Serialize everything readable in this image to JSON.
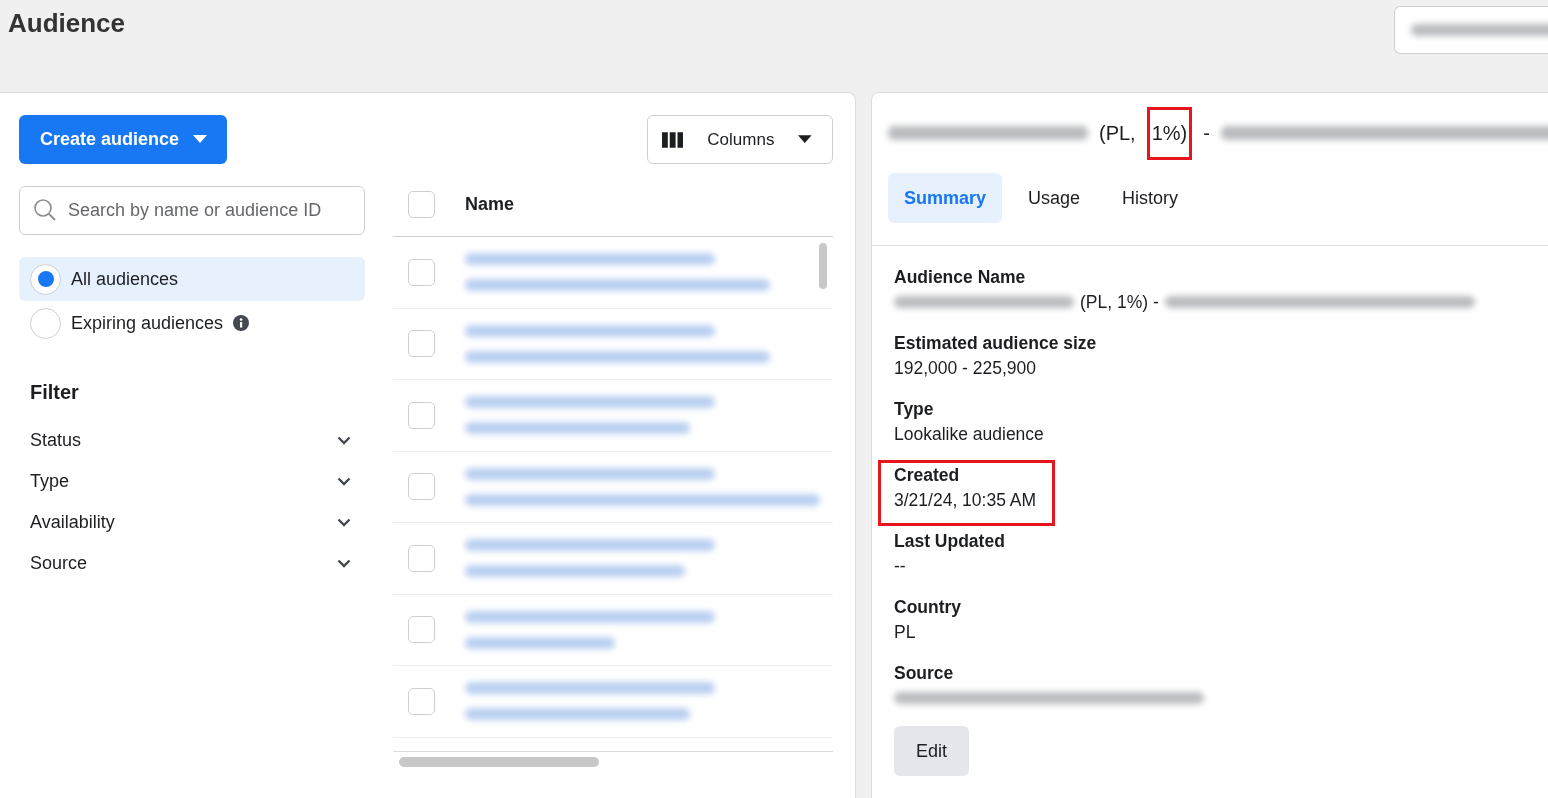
{
  "page": {
    "title": "Audience"
  },
  "account_selector": {
    "kind": "blurred"
  },
  "create_button": {
    "label": "Create audience"
  },
  "search": {
    "placeholder": "Search by name or audience ID"
  },
  "audience_scope": [
    {
      "label": "All audiences",
      "selected": true,
      "info": false
    },
    {
      "label": "Expiring audiences",
      "selected": false,
      "info": true
    }
  ],
  "filter": {
    "title": "Filter",
    "items": [
      {
        "label": "Status",
        "expanded": false
      },
      {
        "label": "Type",
        "expanded": false
      },
      {
        "label": "Availability",
        "expanded": false
      },
      {
        "label": "Source",
        "expanded": false
      }
    ]
  },
  "columns_button": {
    "label": "Columns"
  },
  "table": {
    "columns": [
      "Name"
    ],
    "header_checked": false,
    "rows": [
      {
        "checked": false
      },
      {
        "checked": false
      },
      {
        "checked": false
      },
      {
        "checked": false
      },
      {
        "checked": false
      },
      {
        "checked": false
      },
      {
        "checked": false
      }
    ]
  },
  "detail": {
    "title_parts": [
      {
        "kind": "blurred"
      },
      {
        "kind": "text",
        "text": "(PL,",
        "highlighted": false
      },
      {
        "kind": "text",
        "text": "1%)",
        "highlighted": true
      },
      {
        "kind": "text",
        "text": "-",
        "highlighted": false
      },
      {
        "kind": "blurred"
      }
    ],
    "tabs": [
      {
        "label": "Summary",
        "selected": true
      },
      {
        "label": "Usage",
        "selected": false
      },
      {
        "label": "History",
        "selected": false
      }
    ],
    "fields": [
      {
        "label": "Audience Name",
        "highlighted": false,
        "value_parts": [
          {
            "kind": "blurred"
          },
          {
            "kind": "text",
            "text": "(PL, 1%) -"
          },
          {
            "kind": "blurred"
          }
        ]
      },
      {
        "label": "Estimated audience size",
        "highlighted": false,
        "value_parts": [
          {
            "kind": "text",
            "text": "192,000 - 225,900"
          }
        ]
      },
      {
        "label": "Type",
        "highlighted": false,
        "value_parts": [
          {
            "kind": "text",
            "text": "Lookalike audience"
          }
        ]
      },
      {
        "label": "Created",
        "highlighted": true,
        "value_parts": [
          {
            "kind": "text",
            "text": "3/21/24, 10:35 AM"
          }
        ]
      },
      {
        "label": "Last Updated",
        "highlighted": false,
        "value_parts": [
          {
            "kind": "text",
            "text": "--"
          }
        ]
      },
      {
        "label": "Country",
        "highlighted": false,
        "value_parts": [
          {
            "kind": "text",
            "text": "PL"
          }
        ]
      },
      {
        "label": "Source",
        "highlighted": false,
        "value_parts": [
          {
            "kind": "blurred"
          }
        ]
      }
    ],
    "edit_button": {
      "label": "Edit"
    }
  }
}
